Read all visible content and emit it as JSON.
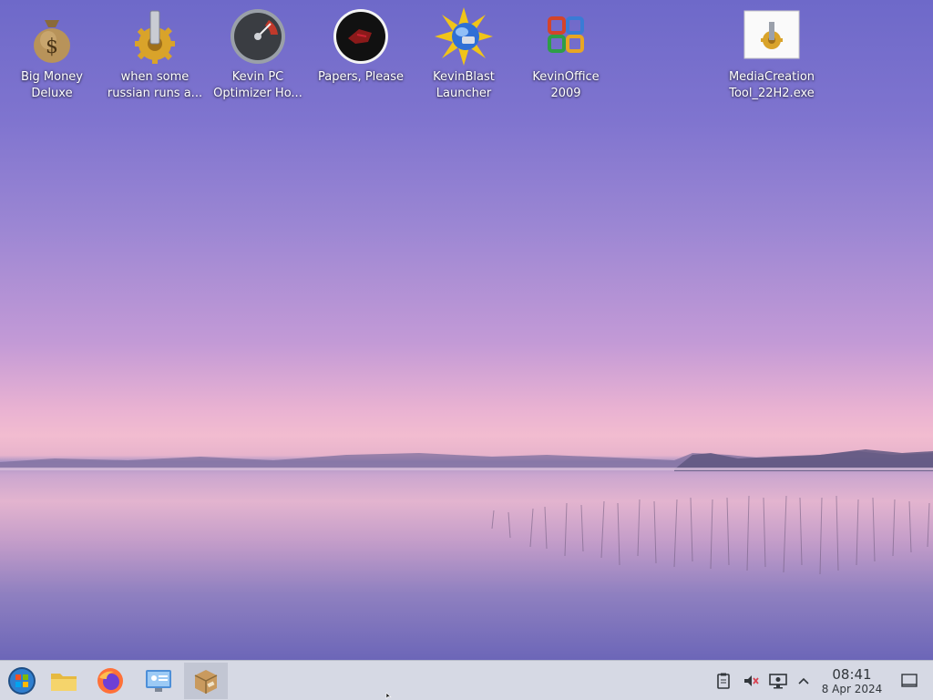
{
  "desktop": {
    "icons": [
      {
        "label": "Big Money\nDeluxe",
        "icon": "money-bag-icon"
      },
      {
        "label": "when some\nrussian runs a...",
        "icon": "gear-icon"
      },
      {
        "label": "Kevin PC\nOptimizer Ho...",
        "icon": "speedometer-icon"
      },
      {
        "label": "Papers, Please",
        "icon": "papers-please-icon"
      },
      {
        "label": "KevinBlast\nLauncher",
        "icon": "starburst-globe-icon"
      },
      {
        "label": "KevinOffice\n2009",
        "icon": "office-logo-icon"
      },
      {
        "label": "MediaCreation\nTool_22H2.exe",
        "icon": "exe-file-icon"
      }
    ]
  },
  "taskbar": {
    "start": {
      "icon": "start-orb-icon"
    },
    "pinned": [
      {
        "name": "file-explorer",
        "icon": "folder-icon"
      },
      {
        "name": "firefox",
        "icon": "firefox-icon"
      },
      {
        "name": "control-panel",
        "icon": "control-panel-icon"
      },
      {
        "name": "package-app",
        "icon": "package-icon"
      }
    ],
    "tray": [
      {
        "icon": "clipboard-icon"
      },
      {
        "icon": "volume-muted-icon"
      },
      {
        "icon": "network-icon"
      },
      {
        "icon": "chevron-up-icon"
      }
    ],
    "clock": {
      "time": "08:41",
      "date": "8 Apr 2024"
    },
    "show_desktop": {
      "icon": "show-desktop-icon"
    }
  },
  "colors": {
    "taskbar": "#d6d9e4",
    "label_text": "#ffffff"
  }
}
